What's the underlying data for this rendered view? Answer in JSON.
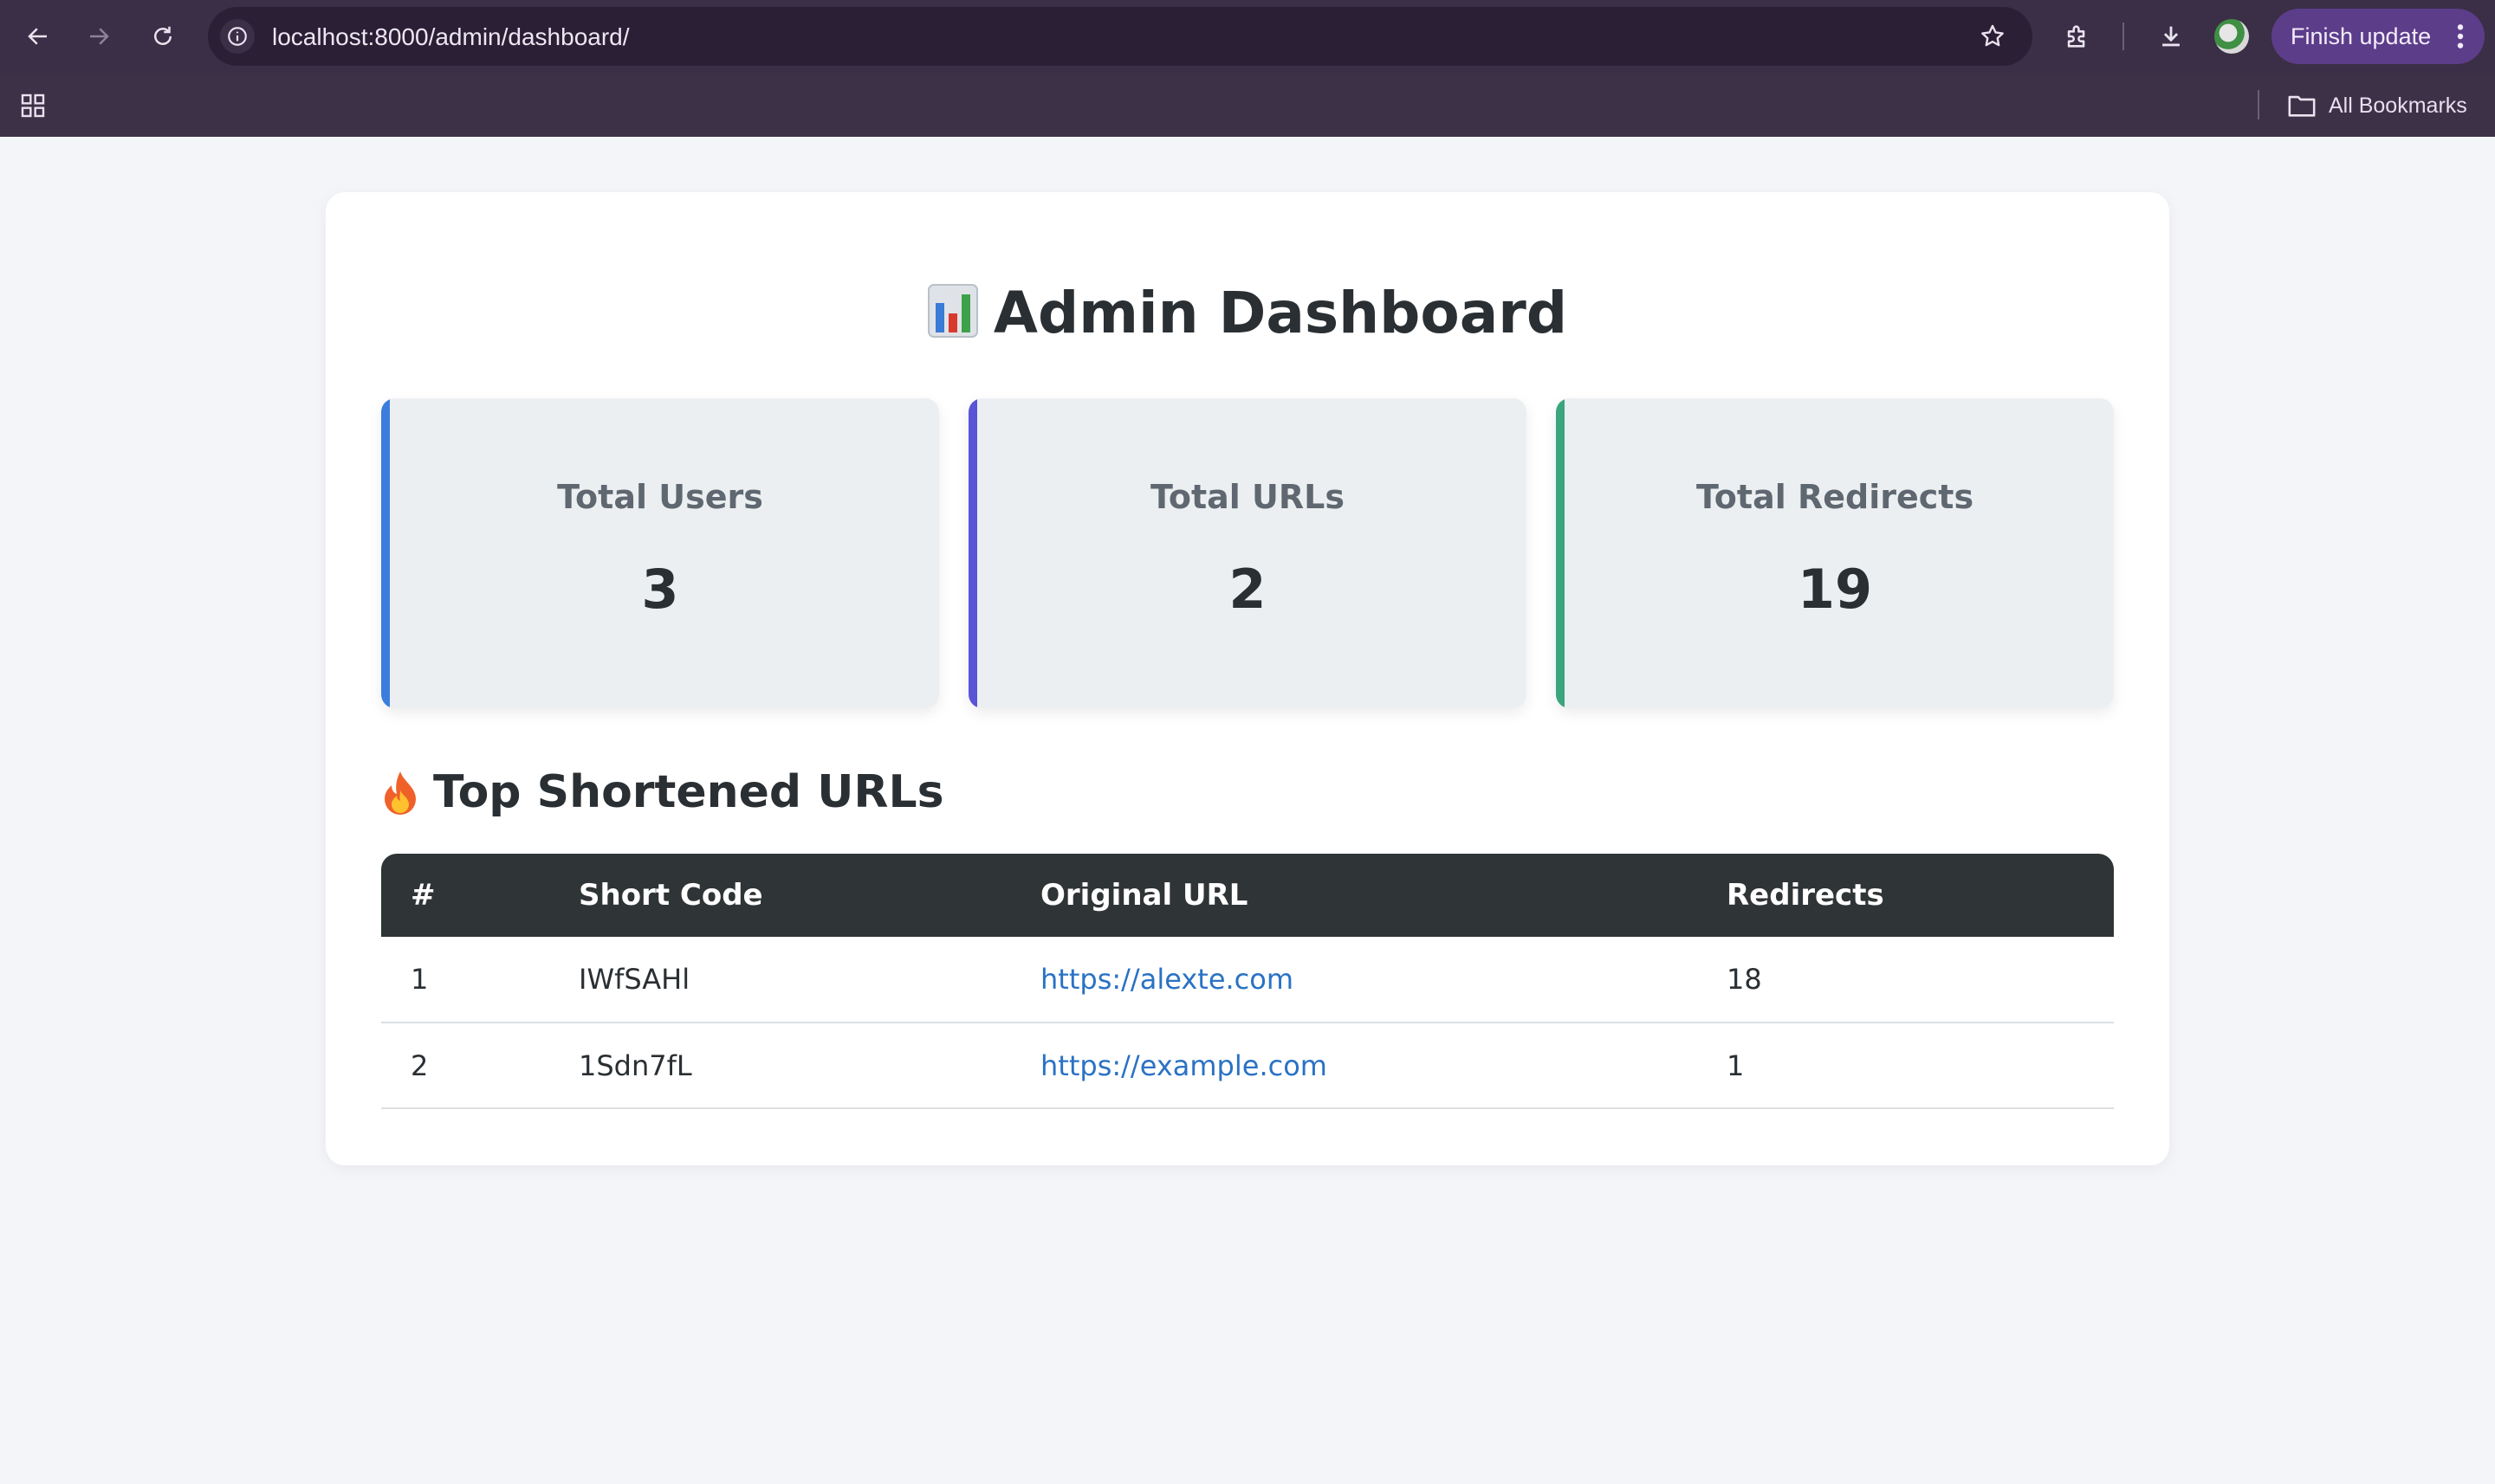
{
  "browser": {
    "url": "localhost:8000/admin/dashboard/",
    "finish_update_label": "Finish update",
    "all_bookmarks_label": "All Bookmarks"
  },
  "page": {
    "title": "Admin Dashboard",
    "title_icon": "bar-chart-emoji",
    "stats": [
      {
        "label": "Total Users",
        "value": "3",
        "accent": "#3b7ddd"
      },
      {
        "label": "Total URLs",
        "value": "2",
        "accent": "#5a55d6"
      },
      {
        "label": "Total Redirects",
        "value": "19",
        "accent": "#3aa57e"
      }
    ],
    "section_title": "Top Shortened URLs",
    "section_icon": "fire-emoji",
    "table": {
      "headers": [
        "#",
        "Short Code",
        "Original URL",
        "Redirects"
      ],
      "rows": [
        {
          "rank": "1",
          "code": "IWfSAHl",
          "url": "https://alexte.com",
          "redirects": "18"
        },
        {
          "rank": "2",
          "code": "1Sdn7fL",
          "url": "https://example.com",
          "redirects": "1"
        }
      ]
    }
  }
}
